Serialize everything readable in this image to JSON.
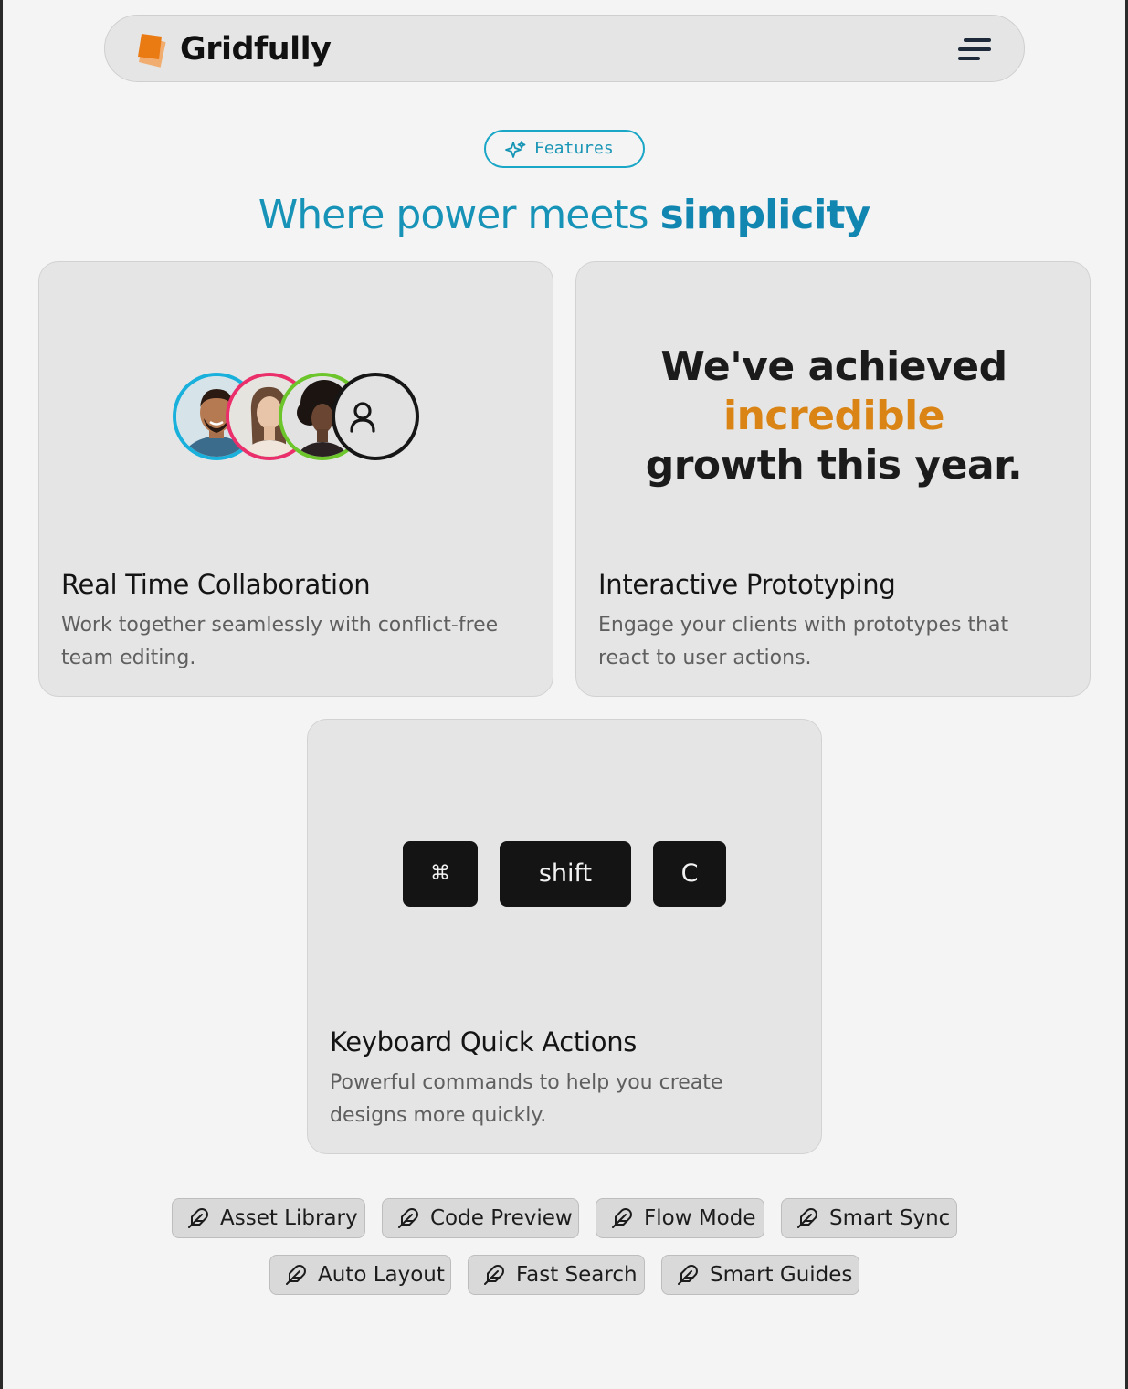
{
  "header": {
    "brand": "Gridfully",
    "logo_icon": "layers-logo-icon",
    "menu_icon": "menu-icon",
    "accent": "#ea7a12"
  },
  "section": {
    "badge": "Features",
    "badge_icon": "sparkles-icon",
    "heading_plain": "Where power meets ",
    "heading_bold": "simplicity",
    "accent": "#1793b8"
  },
  "cards": [
    {
      "title": "Real Time Collaboration",
      "description": "Work together seamlessly with conflict-free team editing.",
      "avatars": [
        "avatar-man",
        "avatar-woman",
        "avatar-woman-curly",
        "avatar-placeholder"
      ],
      "avatar_ring_colors": [
        "#1ab0dc",
        "#ea2f6b",
        "#6cc52a",
        "#161616"
      ]
    },
    {
      "title": "Interactive Prototyping",
      "description": "Engage your clients with prototypes that react to user actions.",
      "quote_line1": "We've achieved",
      "quote_highlight": "incredible",
      "quote_line3": "growth this year."
    },
    {
      "title": "Keyboard Quick Actions",
      "description": "Powerful commands to help you create designs more quickly.",
      "keys": [
        "⌘",
        "shift",
        "C"
      ]
    }
  ],
  "tags": {
    "icon": "feather-icon",
    "row1": [
      "Asset Library",
      "Code Preview",
      "Flow Mode",
      "Smart Sync"
    ],
    "row2": [
      "Auto Layout",
      "Fast Search",
      "Smart Guides"
    ]
  }
}
